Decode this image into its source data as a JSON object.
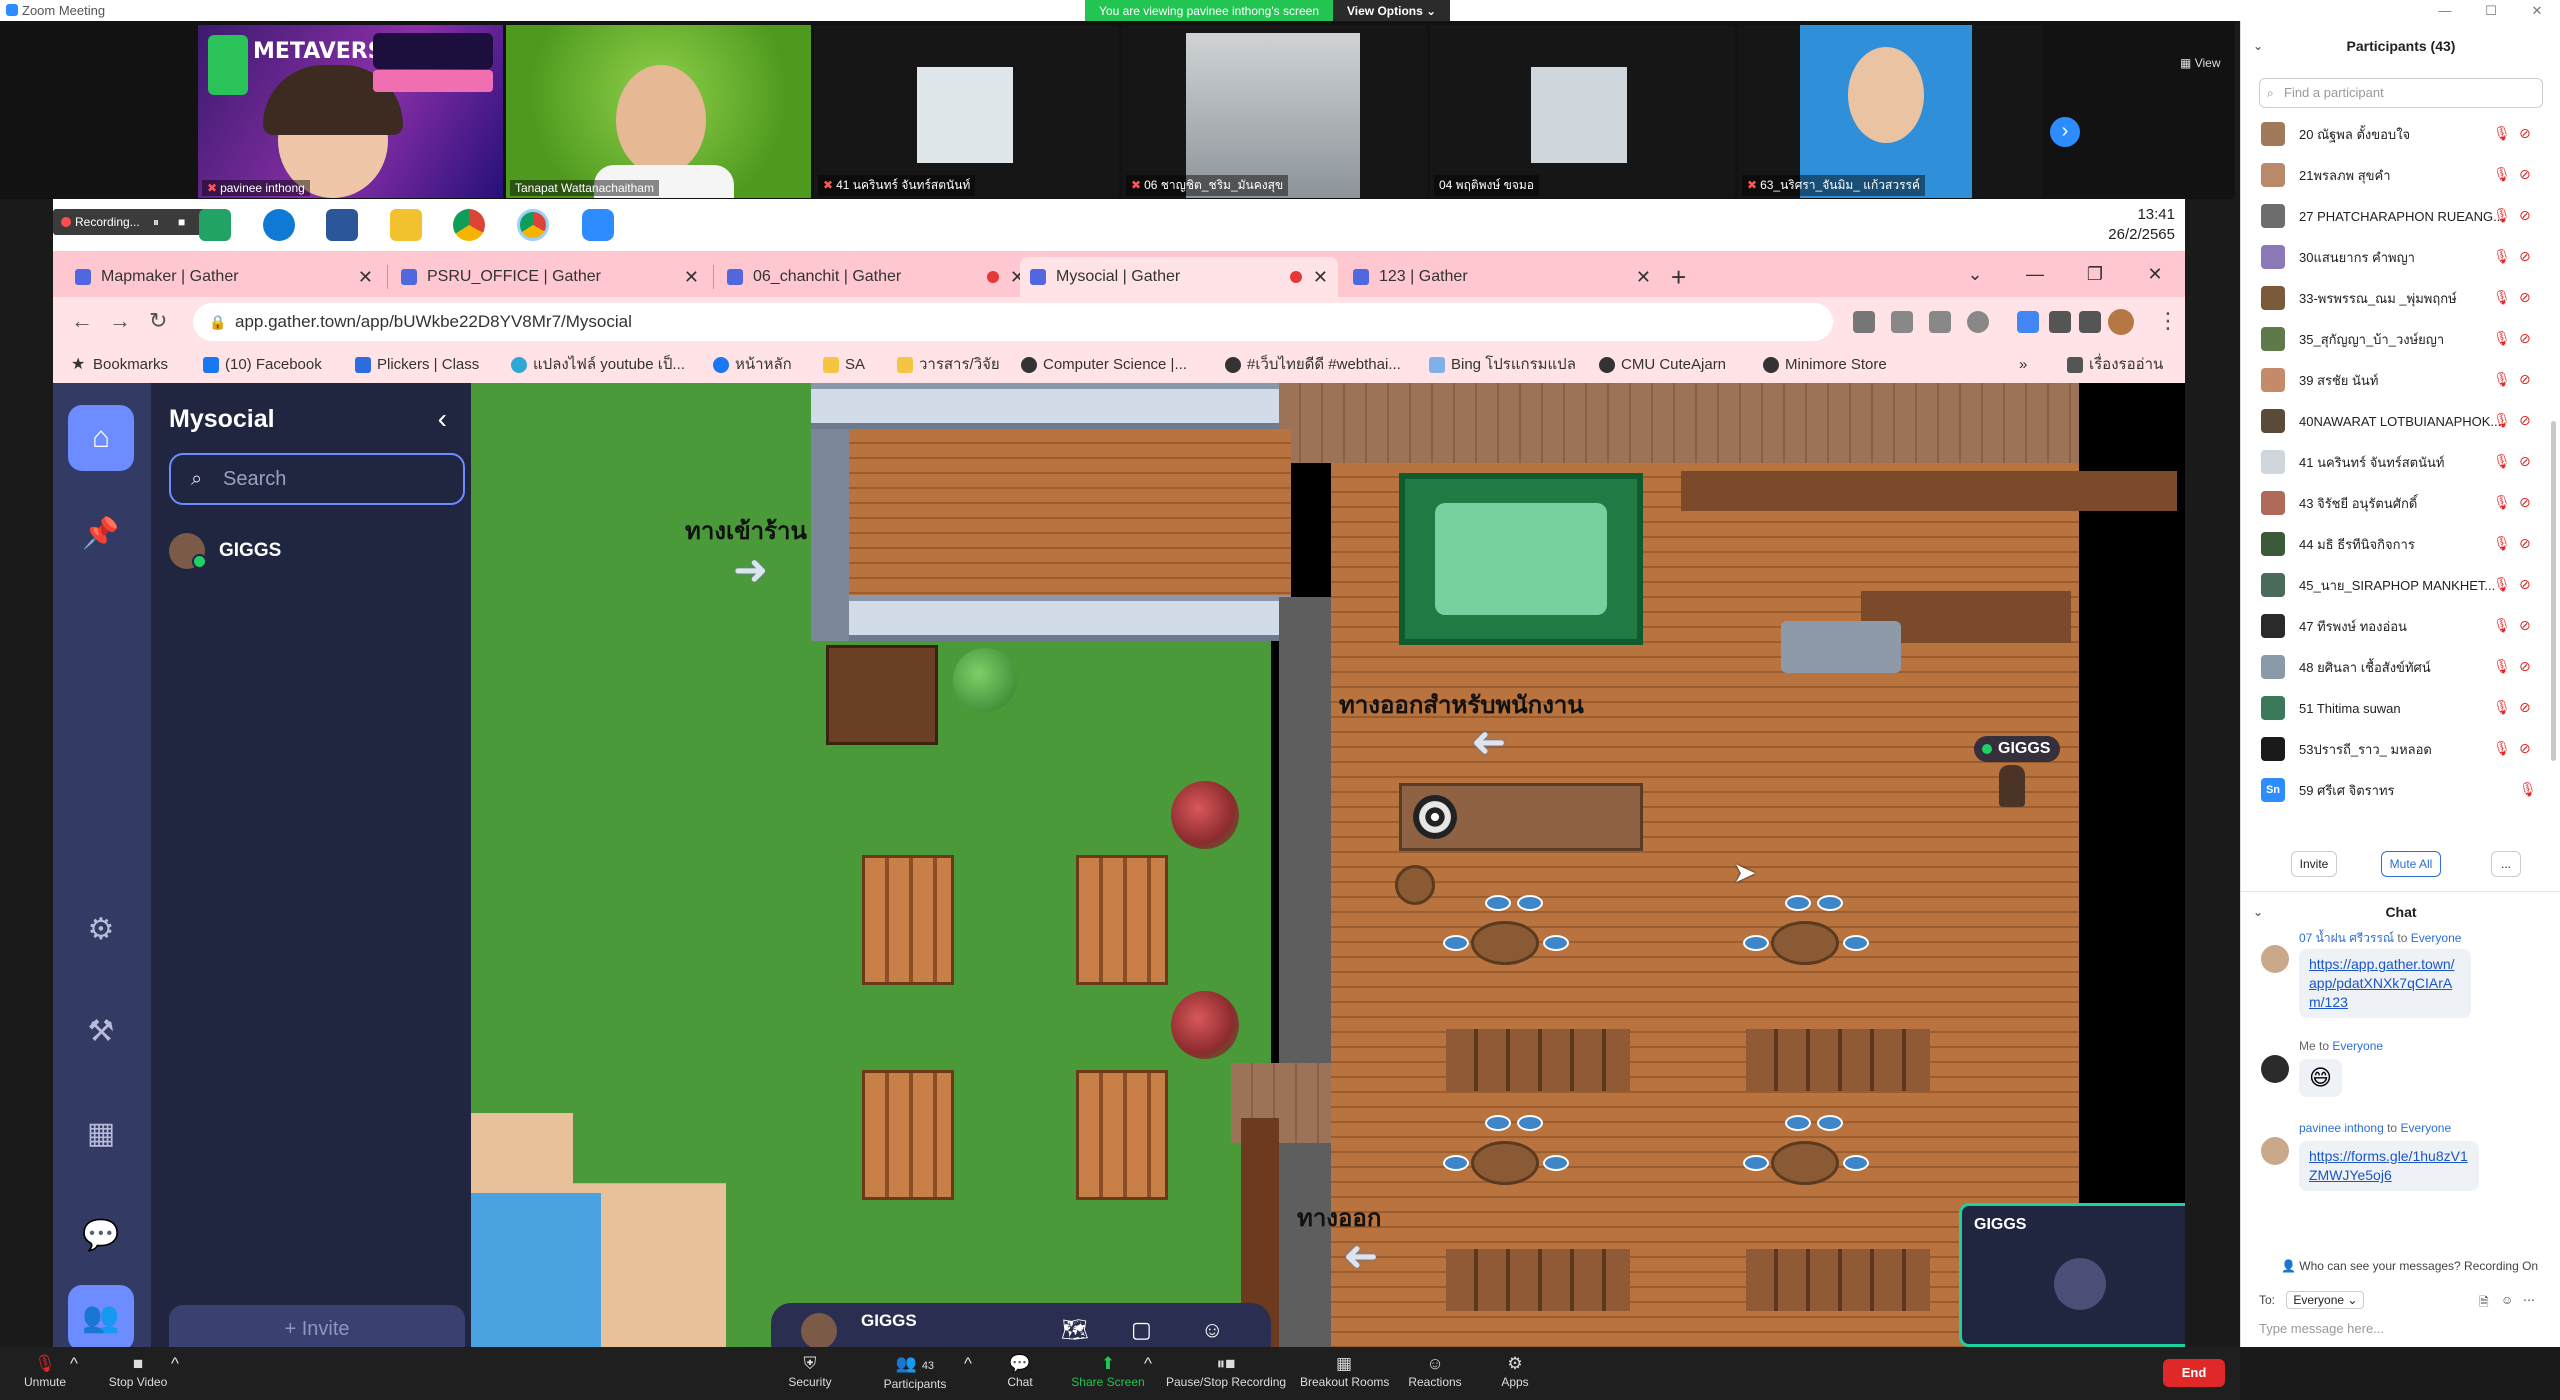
{
  "zoom": {
    "window_title": "Zoom Meeting",
    "viewing_banner": "You are viewing pavinee inthong's screen",
    "view_options": "View Options",
    "view_label": "View",
    "tiles": [
      {
        "name": "pavinee inthong",
        "banner_title": "METAVERSE"
      },
      {
        "name": "Tanapat Wattanachaitham"
      },
      {
        "name": "41 นครินทร์ จันทร์สตนันท์"
      },
      {
        "name": "06 ชาญชิต_ชริม_มันคงสุข"
      },
      {
        "name": "04 พฤติพงษ์ ขจมอ"
      },
      {
        "name": "63_นริศรา_จันมิม_ แก้วสวรรค์"
      }
    ],
    "toolbar": {
      "unmute": "Unmute",
      "stop_video": "Stop Video",
      "security": "Security",
      "participants": "Participants",
      "participants_count": "43",
      "chat": "Chat",
      "share_screen": "Share Screen",
      "pause_recording": "Pause/Stop Recording",
      "breakout_rooms": "Breakout Rooms",
      "reactions": "Reactions",
      "apps": "Apps",
      "end": "End"
    }
  },
  "browser": {
    "recording_label": "Recording...",
    "clock_time": "13:41",
    "clock_date": "26/2/2565",
    "tabs": [
      {
        "title": "Mapmaker | Gather"
      },
      {
        "title": "PSRU_OFFICE | Gather"
      },
      {
        "title": "06_chanchit | Gather"
      },
      {
        "title": "Mysocial | Gather"
      },
      {
        "title": "123 | Gather"
      }
    ],
    "new_tab": "+",
    "url": "app.gather.town/app/bUWkbe22D8YV8Mr7/Mysocial",
    "bookmarks": [
      "Bookmarks",
      "(10) Facebook",
      "Plickers | Class",
      "แปลงไฟล์ youtube เป็...",
      "หน้าหลัก",
      "SA",
      "วารสาร/วิจัย",
      "Computer Science |...",
      "#เว็บไทยดีดี #webthai...",
      "Bing โปรแกรมแปล",
      "CMU CuteAjarn",
      "Minimore Store"
    ],
    "reading_list": "เรื่องรออ่าน"
  },
  "gather": {
    "space_name": "Mysocial",
    "search_placeholder": "Search",
    "user_name": "GIGGS",
    "invite": "Invite",
    "map_labels": {
      "entrance": "ทางเข้าร้าน",
      "staff_exit": "ทางออกสำหรับพนักงาน",
      "exit": "ทางออก"
    },
    "player_tag": "GIGGS",
    "video_name": "GIGGS",
    "bottom_name": "GIGGS"
  },
  "participants_panel": {
    "title": "Participants (43)",
    "search_placeholder": "Find a participant",
    "rows": [
      {
        "name": "20 ณัฐพล ตั้งขอบใจ"
      },
      {
        "name": "21พรลภพ สุขคำ"
      },
      {
        "name": "27 PHATCHARAPHON RUEANG..."
      },
      {
        "name": "30แสนยากร คำพญา"
      },
      {
        "name": "33-พรพรรณ_ณม _พุ่มพฤกษ์"
      },
      {
        "name": "35_สุกัญญา_บ้า_วงษ์ยญา"
      },
      {
        "name": "39 สรชัย นันท์"
      },
      {
        "name": "40NAWARAT LOTBUIANAPHOK..."
      },
      {
        "name": "41 นครินทร์ จันทร์สตนันท์"
      },
      {
        "name": "43 จิรัชยี อนุรัตนศักดิ์"
      },
      {
        "name": "44 มธิ ธีรทีนิจกิจการ"
      },
      {
        "name": "45_นาย_SIRAPHOP MANKHET..."
      },
      {
        "name": "47 ทีรพงษ์ ทองอ่อน"
      },
      {
        "name": "48 ยศินลา เชื้อสังข์ทัศน์"
      },
      {
        "name": "51 Thitima suwan"
      },
      {
        "name": "53ปรารถี_ราว_ มหลอด"
      },
      {
        "name": "59 ศรีเศ จิตราทร",
        "initials": "Sn"
      }
    ],
    "invite": "Invite",
    "mute_all": "Mute All",
    "more": "..."
  },
  "chat_panel": {
    "title": "Chat",
    "to_label": "to",
    "messages": [
      {
        "from": "07 น้ำฝน ศรีวรรณ์",
        "to": "Everyone",
        "text": "https://app.gather.town/app/pdatXNXk7qCIArAm/123"
      },
      {
        "from": "Me",
        "to": "Everyone",
        "text": "😄"
      },
      {
        "from": "pavinee inthong",
        "to": "Everyone",
        "text": "https://forms.gle/1hu8zV1ZMWJYe5oj6"
      }
    ],
    "who_can_see": "Who can see your messages? Recording On",
    "to_prefix": "To:",
    "to_value": "Everyone",
    "input_placeholder": "Type message here..."
  }
}
